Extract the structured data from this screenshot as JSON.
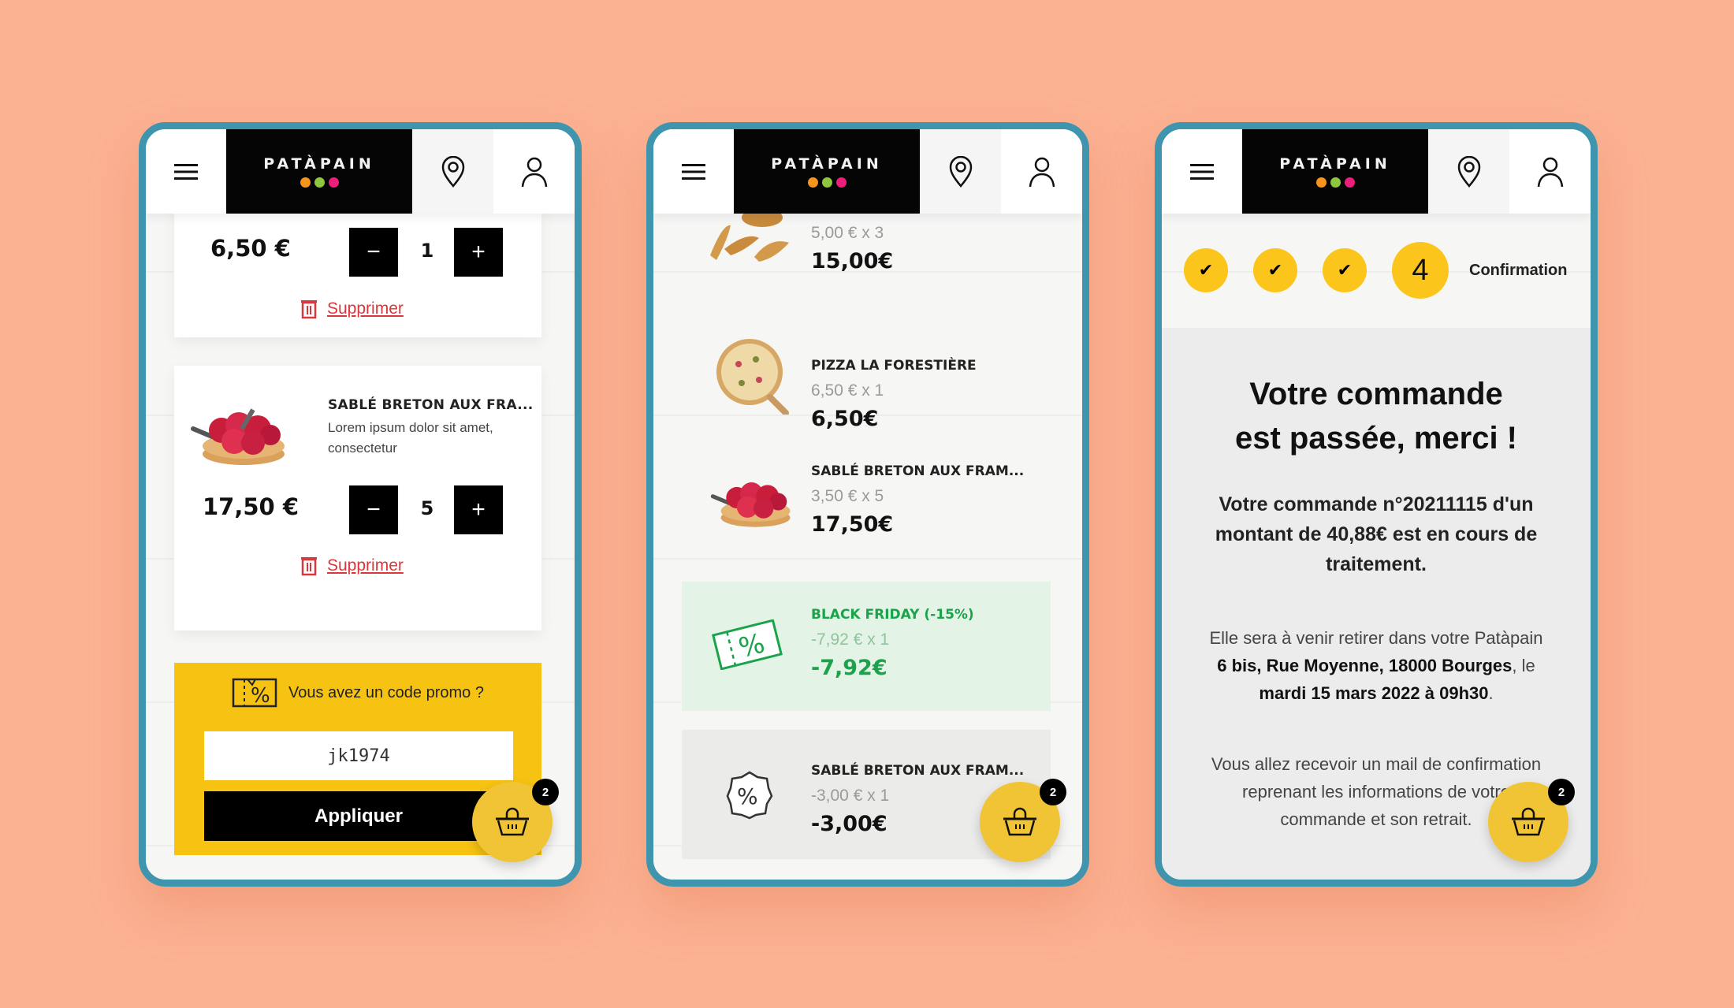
{
  "brand": {
    "name": "PATÀPAIN",
    "dot_colors": [
      "#f7941d",
      "#8dc63f",
      "#ec1e79"
    ]
  },
  "colors": {
    "background": "#fbb293",
    "phone_frame": "#3f95ae",
    "yellow": "#f7c312",
    "delete_red": "#d9373c",
    "discount_green": "#1aa34a"
  },
  "header": {
    "menu_icon": "hamburger-icon",
    "location_icon": "map-pin-icon",
    "account_icon": "user-icon"
  },
  "cart_button": {
    "icon": "basket-icon",
    "badge": "2"
  },
  "panel_cart": {
    "items": [
      {
        "price": "6,50 €",
        "quantity": "1",
        "delete_label": "Supprimer"
      },
      {
        "title": "SABLÉ BRETON AUX FRA...",
        "description": "Lorem ipsum dolor sit amet, consectetur",
        "price": "17,50 €",
        "quantity": "5",
        "delete_label": "Supprimer"
      }
    ],
    "decrement_label": "−",
    "increment_label": "+",
    "promo": {
      "question": "Vous avez un code promo ?",
      "code_value": "jk1974",
      "apply_label": "Appliquer"
    }
  },
  "panel_recap": {
    "lines": [
      {
        "title": "",
        "unit": "5,00 € x 3",
        "total": "15,00€"
      },
      {
        "title": "PIZZA LA FORESTIÈRE",
        "unit": "6,50 € x 1",
        "total": "6,50€"
      },
      {
        "title": "SABLÉ BRETON AUX FRAM...",
        "unit": "3,50 € x 5",
        "total": "17,50€"
      },
      {
        "title": "BLACK FRIDAY (-15%)",
        "unit": "-7,92 € x 1",
        "total": "-7,92€"
      },
      {
        "title": "SABLÉ BRETON AUX FRAM...",
        "unit": "-3,00 € x 1",
        "total": "-3,00€"
      }
    ]
  },
  "panel_confirmation": {
    "steps": [
      "✔",
      "✔",
      "✔",
      "4"
    ],
    "current_step_label": "Confirmation",
    "title_line1": "Votre commande",
    "title_line2": "est passée, merci !",
    "order_text_1": "Votre commande n°",
    "order_number": "20211115",
    "order_text_2": "d'un montant de ",
    "order_amount": "40,88€",
    "order_text_3": " est en cours de traitement.",
    "pickup_text_1": "Elle sera à venir retirer dans votre Patàpain ",
    "pickup_address": "6 bis, Rue Moyenne, 18000 Bourges",
    "pickup_text_2": ", le ",
    "pickup_date": "mardi 15 mars 2022 à 09h30",
    "pickup_text_3": ".",
    "mail_text": "Vous allez recevoir un mail de confirmation reprenant les informations de votre commande et son retrait."
  }
}
